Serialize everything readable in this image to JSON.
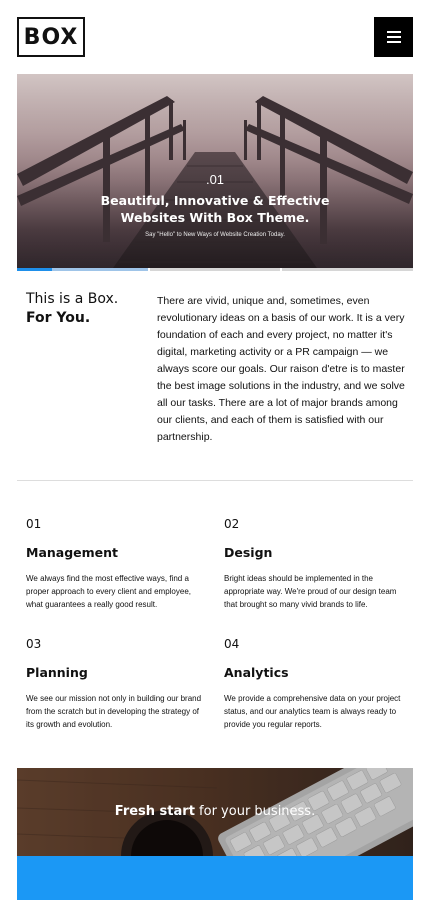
{
  "header": {
    "logo": "BOX",
    "menu_icon": "hamburger-icon"
  },
  "hero": {
    "number": ".01",
    "title_line1": "Beautiful, Innovative & Effective",
    "title_line2": "Websites With Box Theme.",
    "subtitle": "Say \"Hello\" to New Ways of Website Creation Today.",
    "active_slide": 1,
    "slide_count": 3,
    "slide_progress": 0.27
  },
  "intro": {
    "heading_line1": "This is a Box.",
    "heading_line2": "For You.",
    "text": "There are vivid, unique and, sometimes, even revolutionary ideas on a basis of our work. It is a very foundation of each and every project, no matter it's digital, marketing activity or a PR campaign — we always score our goals. Our raison d'etre is to master the best image solutions in the industry, and we solve all our tasks. There are a lot of major brands among our clients, and each of them is satisfied with our partnership."
  },
  "features": [
    {
      "num": "01",
      "title": "Management",
      "desc": "We always find the most effective ways, find a proper approach to every client and employee, what guarantees a really good result."
    },
    {
      "num": "02",
      "title": "Design",
      "desc": "Bright ideas should be implemented in the appropriate way. We're proud of our design team that brought so many vivid brands to life."
    },
    {
      "num": "03",
      "title": "Planning",
      "desc": "We see our mission not only in building our brand from the scratch but in developing the strategy of its growth and evolution."
    },
    {
      "num": "04",
      "title": "Analytics",
      "desc": "We provide a comprehensive data on your project status, and our analytics team is always ready to provide you regular reports."
    }
  ],
  "banner": {
    "bold": "Fresh start",
    "rest": " for your business."
  }
}
